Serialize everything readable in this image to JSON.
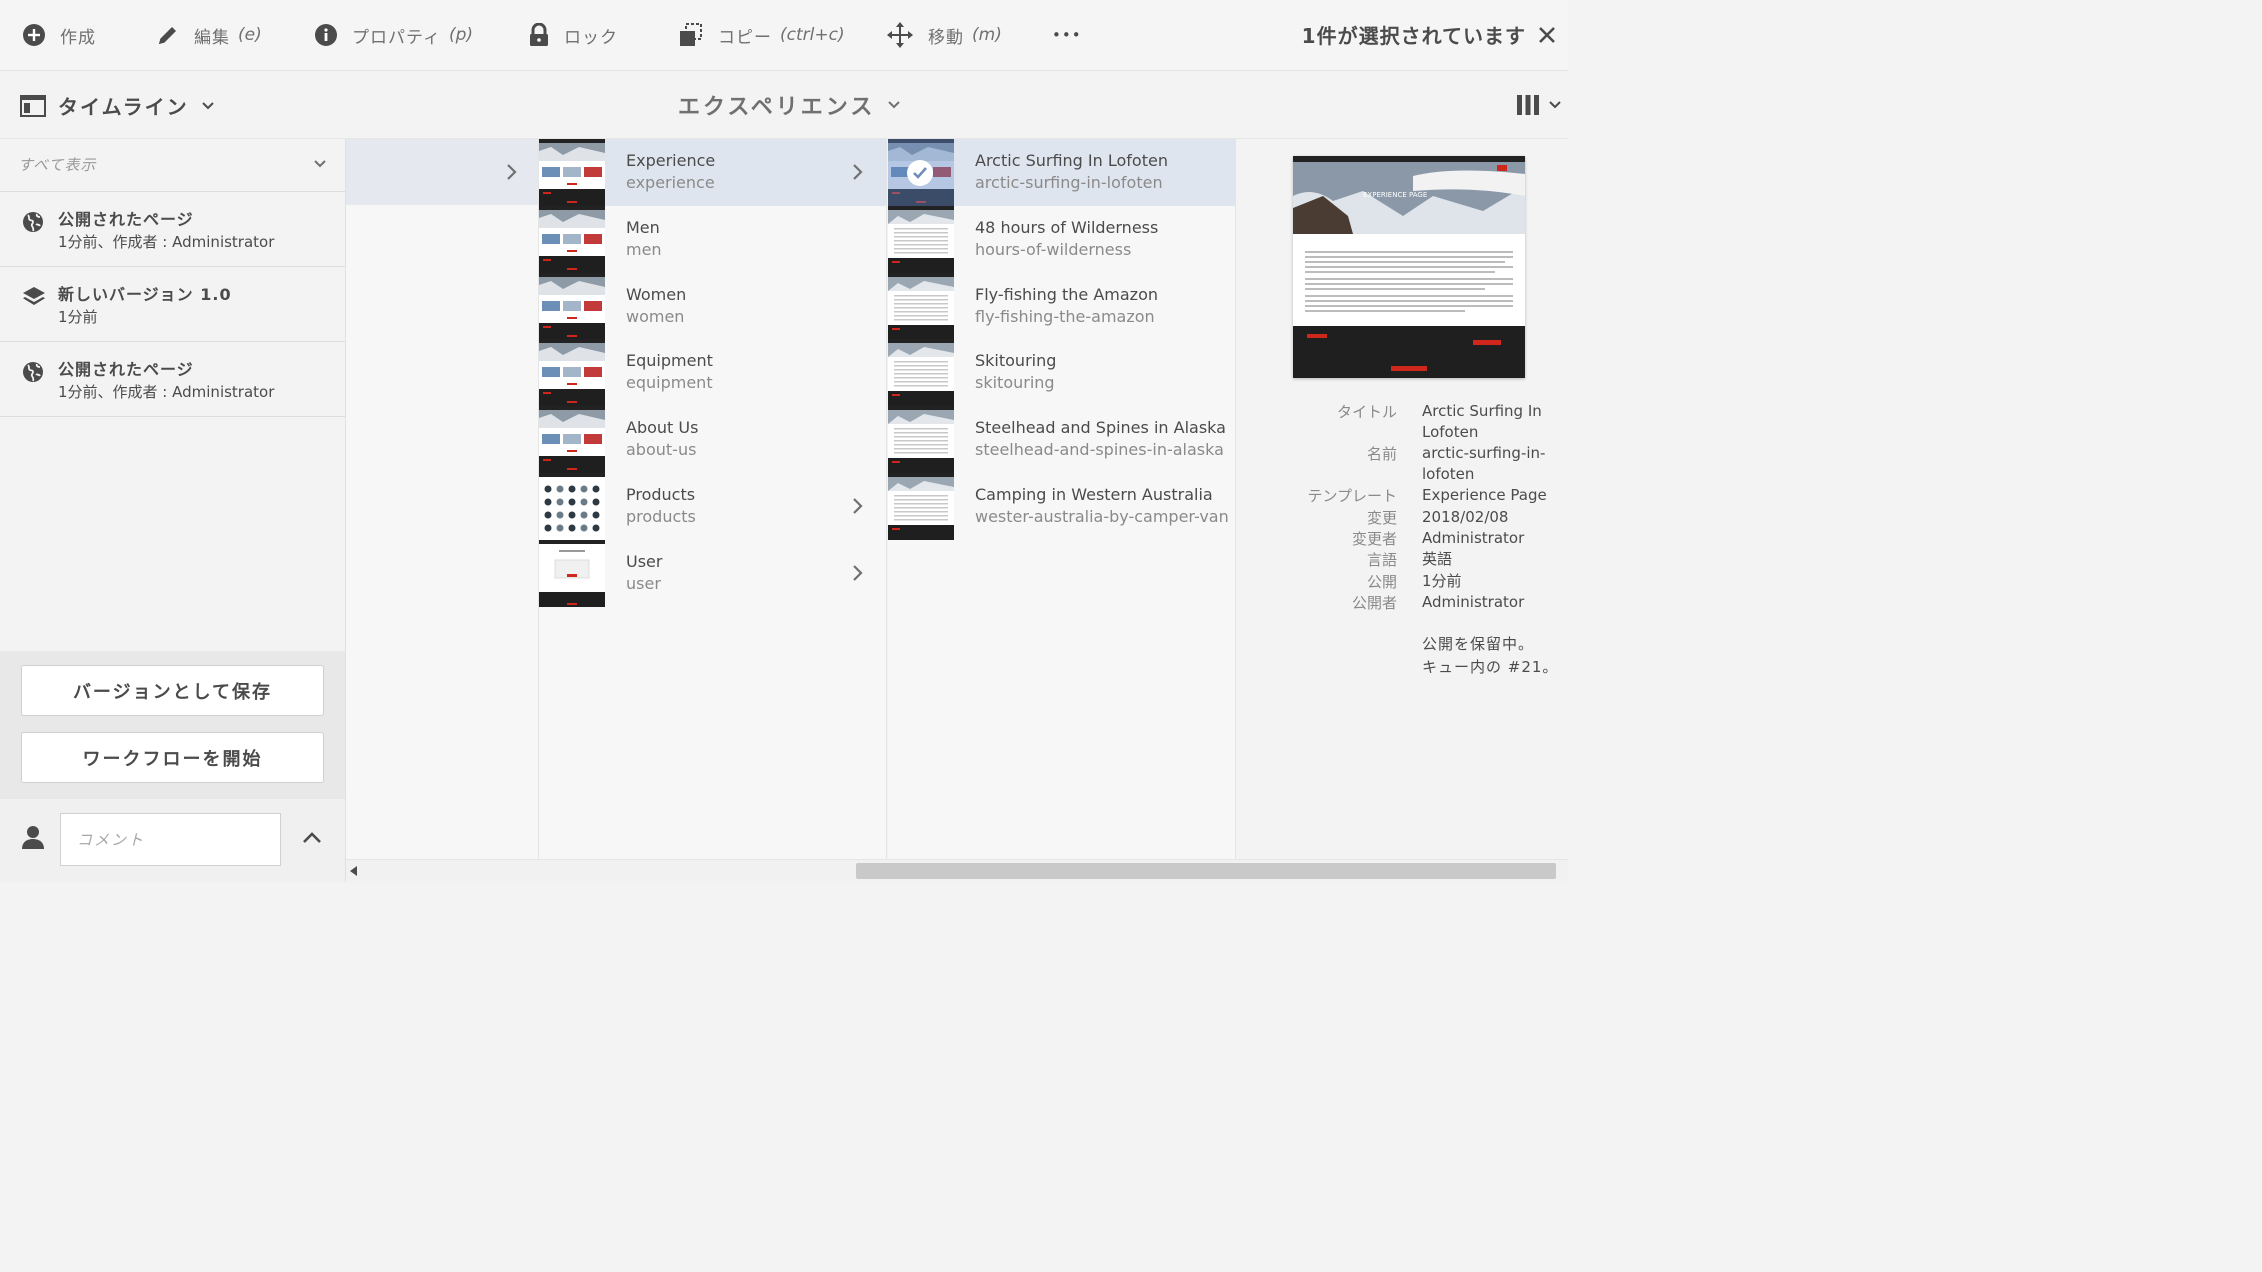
{
  "toolbar": {
    "create": "作成",
    "edit": "編集",
    "edit_shortcut": "(e)",
    "properties": "プロパティ",
    "properties_shortcut": "(p)",
    "lock": "ロック",
    "copy": "コピー",
    "copy_shortcut": "(ctrl+c)",
    "move": "移動",
    "move_shortcut": "(m)",
    "more": "•••",
    "selection_status": "1件が選択されています"
  },
  "header": {
    "rail_title": "タイムライン",
    "breadcrumb_title": "エクスペリエンス"
  },
  "timeline": {
    "filter_placeholder": "すべて表示",
    "items": [
      {
        "icon": "globe-icon",
        "title": "公開されたページ",
        "sub": "1分前、作成者 : Administrator"
      },
      {
        "icon": "layers-icon",
        "title": "新しいバージョン 1.0",
        "sub": "1分前"
      },
      {
        "icon": "globe-icon",
        "title": "公開されたページ",
        "sub": "1分前、作成者 : Administrator"
      }
    ],
    "save_version": "バージョンとして保存",
    "start_workflow": "ワークフローを開始",
    "comment_placeholder": "コメント"
  },
  "column1": {
    "rows": [
      {
        "title": "Experience",
        "name": "experience",
        "selected": true,
        "has_children": true
      },
      {
        "title": "Men",
        "name": "men",
        "selected": false,
        "has_children": false
      },
      {
        "title": "Women",
        "name": "women",
        "selected": false,
        "has_children": false
      },
      {
        "title": "Equipment",
        "name": "equipment",
        "selected": false,
        "has_children": false
      },
      {
        "title": "About Us",
        "name": "about-us",
        "selected": false,
        "has_children": false
      },
      {
        "title": "Products",
        "name": "products",
        "selected": false,
        "has_children": true
      },
      {
        "title": "User",
        "name": "user",
        "selected": false,
        "has_children": true
      }
    ]
  },
  "column2": {
    "rows": [
      {
        "title": "Arctic Surfing In Lofoten",
        "name": "arctic-surfing-in-lofoten",
        "selected": true
      },
      {
        "title": "48 hours of Wilderness",
        "name": "hours-of-wilderness",
        "selected": false
      },
      {
        "title": "Fly-fishing the Amazon",
        "name": "fly-fishing-the-amazon",
        "selected": false
      },
      {
        "title": "Skitouring",
        "name": "skitouring",
        "selected": false
      },
      {
        "title": "Steelhead and Spines in Alaska",
        "name": "steelhead-and-spines-in-alaska",
        "selected": false
      },
      {
        "title": "Camping in Western Australia",
        "name": "wester-australia-by-camper-van",
        "selected": false
      }
    ]
  },
  "details": {
    "preview_heading": "EXPERIENCE PAGE",
    "fields": [
      {
        "key": "タイトル",
        "value": "Arctic Surfing In Lofoten"
      },
      {
        "key": "名前",
        "value": "arctic-surfing-in-lofoten"
      },
      {
        "key": "テンプレート",
        "value": "Experience Page"
      },
      {
        "key": "変更",
        "value": "2018/02/08"
      },
      {
        "key": "変更者",
        "value": "Administrator"
      },
      {
        "key": "言語",
        "value": "英語"
      },
      {
        "key": "公開",
        "value": "1分前"
      },
      {
        "key": "公開者",
        "value": "Administrator"
      }
    ],
    "publish_note_1": "公開を保留中。",
    "publish_note_2": "キュー内の #21。"
  },
  "colors": {
    "selected_row": "#dfe5ef",
    "accent_red": "#d0271d",
    "text": "#4b4b4b"
  }
}
